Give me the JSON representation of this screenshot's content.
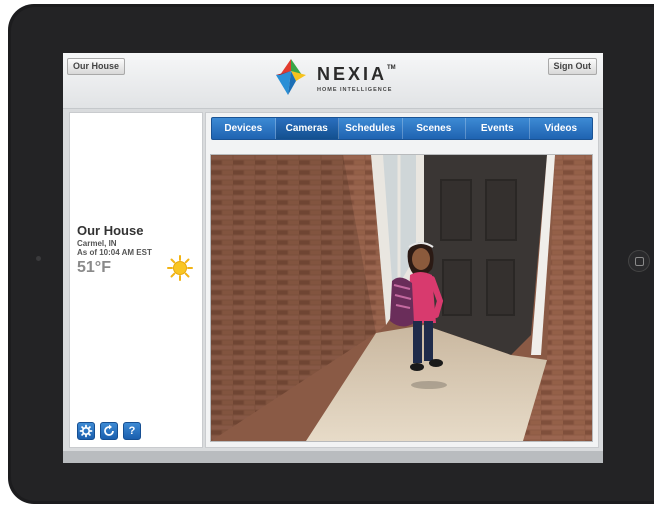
{
  "header": {
    "location_button": "Our House",
    "signout_button": "Sign Out",
    "logo": {
      "name": "NEXIA",
      "trademark": "TM",
      "tagline": "HOME INTELLIGENCE"
    }
  },
  "info": {
    "location_name": "Our House",
    "city": "Carmel, IN",
    "as_of": "As of 10:04 AM EST",
    "temperature": "51°F",
    "weather_icon": "sun-icon"
  },
  "tools": {
    "settings_icon": "gear-icon",
    "refresh_icon": "refresh-icon",
    "help_label": "?"
  },
  "nav": {
    "tabs": [
      {
        "label": "Devices"
      },
      {
        "label": "Cameras",
        "active": true
      },
      {
        "label": "Schedules"
      },
      {
        "label": "Scenes"
      },
      {
        "label": "Events"
      },
      {
        "label": "Videos"
      }
    ]
  },
  "camera": {
    "feed": "front-door-camera"
  },
  "colors": {
    "accent": "#2468b5",
    "brand_red": "#e23b2e",
    "brand_green": "#3aa548",
    "brand_blue": "#2a8fd6",
    "brand_yellow": "#f6c21c"
  }
}
